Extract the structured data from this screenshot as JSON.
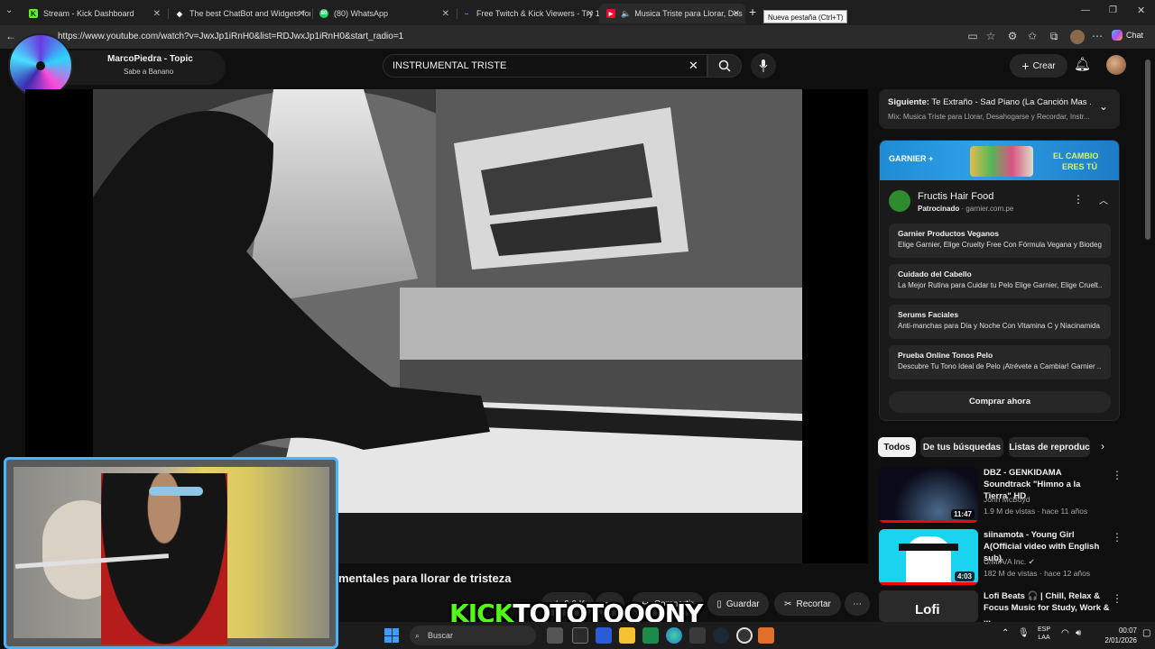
{
  "browser": {
    "tabs": [
      {
        "title": "Stream - Kick Dashboard",
        "icon": "K"
      },
      {
        "title": "The best ChatBot and Widgets for",
        "icon": "◆"
      },
      {
        "title": "(80) WhatsApp",
        "icon": "80"
      },
      {
        "title": "Free Twitch & Kick Viewers - Try 1",
        "icon": "~"
      },
      {
        "title": "Musica Triste para Llorar, Des",
        "icon": "▶"
      }
    ],
    "new_tab_tooltip": "Nueva pestaña (Ctrl+T)",
    "url": "https://www.youtube.com/watch?v=JwxJp1iRnH0&list=RDJwxJp1iRnH0&start_radio=1",
    "chat_label": "Chat"
  },
  "overlay": {
    "song_title": "MarcoPiedra - Topic",
    "song_artist": "Sabe a Banano",
    "kick_part1": "KICK",
    "kick_part2": "TOTOTOOONY"
  },
  "youtube": {
    "search_value": "INSTRUMENTAL TRISTE",
    "create_label": "Crear",
    "video_title_visible": "mentales para llorar de tristeza",
    "actions": {
      "likes": "6,6 K",
      "share": "Compartir",
      "save": "Guardar",
      "clip": "Recortar"
    },
    "next": {
      "label": "Siguiente:",
      "title": "Te Extraño - Sad Piano (La Canción Mas ...",
      "subtitle": "Mix: Musica Triste para Llorar, Desahogarse y Recordar, Instr..."
    },
    "ad": {
      "banner_left": "GARNIER +",
      "banner_right1": "EL CAMBIO",
      "banner_right2": "ERES TÚ",
      "advertiser": "Fructis Hair Food",
      "sponsored": "Patrocinado",
      "domain": "garnier.com.pe",
      "rows": [
        {
          "h": "Garnier Productos Veganos",
          "d": "Elige Garnier, Elige Cruelty Free Con Fórmula Vegana y Biodeg..."
        },
        {
          "h": "Cuidado del Cabello",
          "d": "La Mejor Rutina para Cuidar tu Pelo Elige Garnier, Elige Cruelt..."
        },
        {
          "h": "Serums Faciales",
          "d": "Anti-manchas para Día y Noche Con Vitamina C y Niacinamida"
        },
        {
          "h": "Prueba Online Tonos Pelo",
          "d": "Descubre Tu Tono Ideal de Pelo ¡Atrévete a Cambiar! Garnier ..."
        }
      ],
      "cta": "Comprar ahora"
    },
    "chips": [
      "Todos",
      "De tus búsquedas",
      "Listas de reproduc"
    ],
    "recommendations": [
      {
        "title": "DBZ - GENKIDAMA Soundtrack \"Himno a la Tierra\" HD",
        "channel": "John McBoyd",
        "meta": "1.9 M de vistas · hace 11 años",
        "duration": "11:47"
      },
      {
        "title": "siinamota - Young Girl A(Official video with English sub)",
        "channel": "U/M/A/A Inc.",
        "meta": "182 M de vistas · hace 12 años",
        "duration": "4:03"
      },
      {
        "title": "Lofi Beats 🎧 | Chill, Relax & Focus Music for Study, Work & ...",
        "channel": "",
        "meta": "",
        "duration": "",
        "thumb_text": "Lofi"
      }
    ]
  },
  "taskbar": {
    "search_placeholder": "Buscar",
    "lang1": "ESP",
    "lang2": "LAA",
    "time": "00:07",
    "date": "2/01/2026"
  }
}
